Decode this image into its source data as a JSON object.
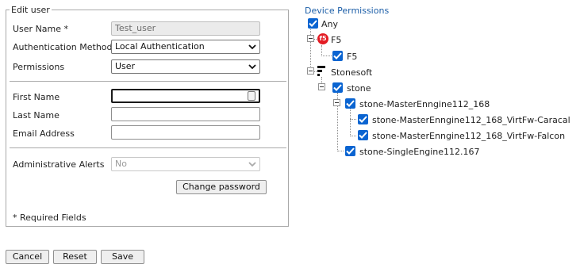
{
  "form": {
    "legend": "Edit user",
    "username_label": "User Name *",
    "username_value": "Test_user",
    "auth_label": "Authentication Method",
    "auth_value": "Local Authentication",
    "permissions_label": "Permissions",
    "permissions_value": "User",
    "first_name_label": "First Name",
    "first_name_value": "",
    "last_name_label": "Last Name",
    "last_name_value": "",
    "email_label": "Email Address",
    "email_value": "",
    "alerts_label": "Administrative Alerts",
    "alerts_value": "No",
    "change_password_label": "Change password",
    "required_note": "* Required Fields"
  },
  "buttons": {
    "cancel": "Cancel",
    "reset": "Reset",
    "save": "Save"
  },
  "tree": {
    "title": "Device Permissions",
    "any": "Any",
    "f5_group": "F5",
    "f5_device": "F5",
    "stonesoft_group": "Stonesoft",
    "stone": "stone",
    "master_engine": "stone-MasterEnngine112_168",
    "virt_caracal": "stone-MasterEnngine112_168_VirtFw-Caracal",
    "virt_falcon": "stone-MasterEnngine112_168_VirtFw-Falcon",
    "single_engine": "stone-SingleEngine112.167"
  },
  "colors": {
    "checkbox": "#0a64d1",
    "tree_title": "#1d5fa8",
    "f5_brand": "#e31b23"
  }
}
